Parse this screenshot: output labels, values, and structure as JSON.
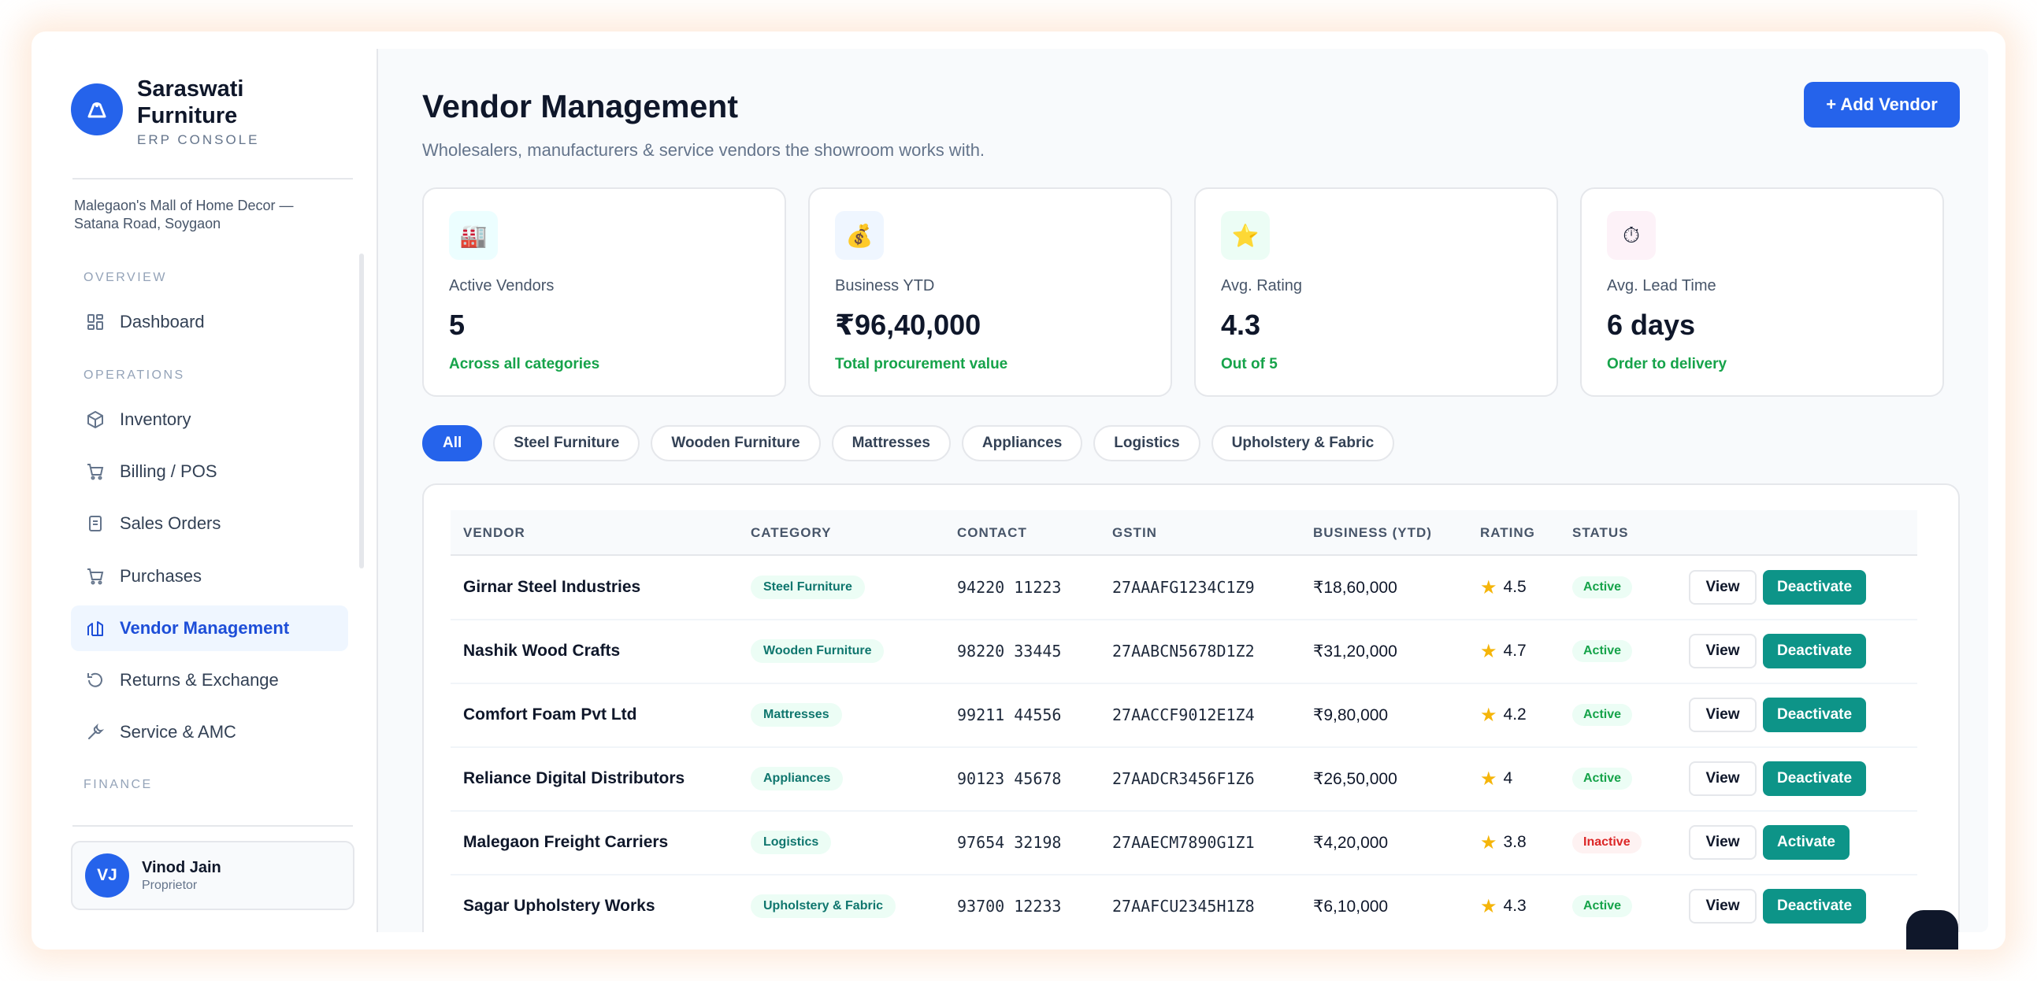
{
  "brand": {
    "name_line1": "Saraswati",
    "name_line2": "Furniture",
    "subtitle": "ERP CONSOLE",
    "store_address": "Malegaon's Mall of Home Decor — Satana Road, Soygaon"
  },
  "sidebar": {
    "sections": {
      "overview": "OVERVIEW",
      "operations": "OPERATIONS",
      "finance": "FINANCE"
    },
    "items": [
      {
        "label": "Dashboard",
        "icon": "grid-icon"
      },
      {
        "label": "Inventory",
        "icon": "box-icon"
      },
      {
        "label": "Billing / POS",
        "icon": "cart-icon"
      },
      {
        "label": "Sales Orders",
        "icon": "document-icon"
      },
      {
        "label": "Purchases",
        "icon": "cart-icon"
      },
      {
        "label": "Vendor Management",
        "icon": "store-icon",
        "active": true
      },
      {
        "label": "Returns & Exchange",
        "icon": "rotate-icon"
      },
      {
        "label": "Service & AMC",
        "icon": "wrench-icon"
      }
    ]
  },
  "user": {
    "initials": "VJ",
    "name": "Vinod Jain",
    "role": "Proprietor"
  },
  "header": {
    "title": "Vendor Management",
    "subtitle": "Wholesalers, manufacturers & service vendors the showroom works with.",
    "add_button": "+ Add Vendor"
  },
  "stats": [
    {
      "label": "Active Vendors",
      "value": "5",
      "note": "Across all categories",
      "icon": "factory-icon",
      "icon_glyph": "🏭",
      "bg": "#ecfeff"
    },
    {
      "label": "Business YTD",
      "value": "₹96,40,000",
      "note": "Total procurement value",
      "icon": "money-bag-icon",
      "icon_glyph": "💰",
      "bg": "#eff6ff"
    },
    {
      "label": "Avg. Rating",
      "value": "4.3",
      "note": "Out of 5",
      "icon": "star-icon",
      "icon_glyph": "⭐",
      "bg": "#ecfdf5"
    },
    {
      "label": "Avg. Lead Time",
      "value": "6 days",
      "note": "Order to delivery",
      "icon": "stopwatch-icon",
      "icon_glyph": "⏱",
      "bg": "#fdf2f8"
    }
  ],
  "filters": [
    "All",
    "Steel Furniture",
    "Wooden Furniture",
    "Mattresses",
    "Appliances",
    "Logistics",
    "Upholstery & Fabric"
  ],
  "table": {
    "columns": [
      "VENDOR",
      "CATEGORY",
      "CONTACT",
      "GSTIN",
      "BUSINESS (YTD)",
      "RATING",
      "STATUS"
    ],
    "rows": [
      {
        "vendor": "Girnar Steel Industries",
        "category": "Steel Furniture",
        "contact": "94220 11223",
        "gstin": "27AAAFG1234C1Z9",
        "business": "₹18,60,000",
        "rating": "4.5",
        "status": "Active",
        "status_kind": "active",
        "view": "View",
        "toggle": "Deactivate"
      },
      {
        "vendor": "Nashik Wood Crafts",
        "category": "Wooden Furniture",
        "contact": "98220 33445",
        "gstin": "27AABCN5678D1Z2",
        "business": "₹31,20,000",
        "rating": "4.7",
        "status": "Active",
        "status_kind": "active",
        "view": "View",
        "toggle": "Deactivate"
      },
      {
        "vendor": "Comfort Foam Pvt Ltd",
        "category": "Mattresses",
        "contact": "99211 44556",
        "gstin": "27AACCF9012E1Z4",
        "business": "₹9,80,000",
        "rating": "4.2",
        "status": "Active",
        "status_kind": "active",
        "view": "View",
        "toggle": "Deactivate"
      },
      {
        "vendor": "Reliance Digital Distributors",
        "category": "Appliances",
        "contact": "90123 45678",
        "gstin": "27AADCR3456F1Z6",
        "business": "₹26,50,000",
        "rating": "4",
        "status": "Active",
        "status_kind": "active",
        "view": "View",
        "toggle": "Deactivate"
      },
      {
        "vendor": "Malegaon Freight Carriers",
        "category": "Logistics",
        "contact": "97654 32198",
        "gstin": "27AAECM7890G1Z1",
        "business": "₹4,20,000",
        "rating": "3.8",
        "status": "Inactive",
        "status_kind": "inactive",
        "view": "View",
        "toggle": "Activate"
      },
      {
        "vendor": "Sagar Upholstery Works",
        "category": "Upholstery & Fabric",
        "contact": "93700 12233",
        "gstin": "27AAFCU2345H1Z8",
        "business": "₹6,10,000",
        "rating": "4.3",
        "status": "Active",
        "status_kind": "active",
        "view": "View",
        "toggle": "Deactivate"
      }
    ]
  }
}
